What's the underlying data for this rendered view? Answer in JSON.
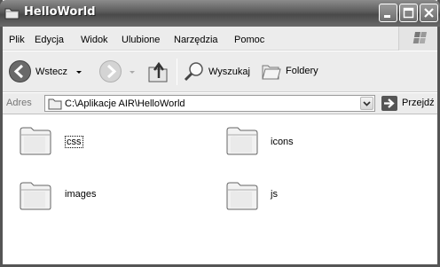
{
  "window": {
    "title": "HelloWorld"
  },
  "menu": {
    "items": [
      "Plik",
      "Edycja",
      "Widok",
      "Ulubione",
      "Narzędzia",
      "Pomoc"
    ]
  },
  "toolbar": {
    "back_label": "Wstecz",
    "search_label": "Wyszukaj",
    "folders_label": "Foldery"
  },
  "address": {
    "label": "Adres",
    "value": "C:\\Aplikacje AIR\\HelloWorld",
    "go_label": "Przejdź"
  },
  "folders": [
    {
      "name": "css",
      "icon": "folder-icon"
    },
    {
      "name": "icons",
      "icon": "folder-icon"
    },
    {
      "name": "images",
      "icon": "folder-icon"
    },
    {
      "name": "js",
      "icon": "folder-icon"
    }
  ]
}
